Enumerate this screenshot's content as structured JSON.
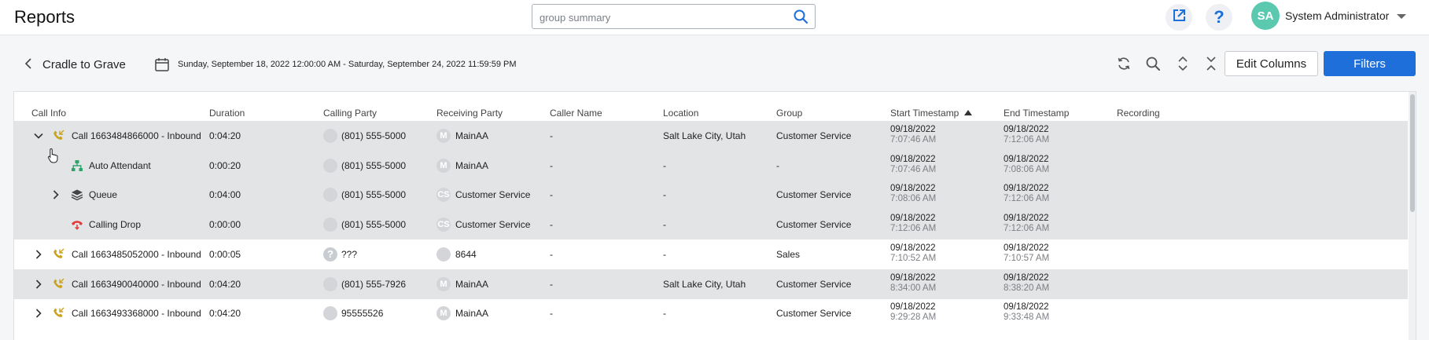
{
  "header": {
    "title": "Reports",
    "search_placeholder": "group summary",
    "user": {
      "initials": "SA",
      "name": "System Administrator"
    }
  },
  "toolbar": {
    "report_name": "Cradle to Grave",
    "date_range": "Sunday, September 18, 2022 12:00:00 AM - Saturday, September 24, 2022 11:59:59 PM",
    "edit_columns_label": "Edit Columns",
    "filters_label": "Filters"
  },
  "table": {
    "columns": [
      "Call Info",
      "Duration",
      "Calling Party",
      "Receiving Party",
      "Caller Name",
      "Location",
      "Group",
      "Start Timestamp",
      "End Timestamp",
      "Recording"
    ],
    "sorted_column": "Start Timestamp",
    "sort_direction": "ascending",
    "rows": [
      {
        "expander": "expanded",
        "indent": 0,
        "icon": "phone-inbound-icon",
        "call_info": "Call 1663484866000 - Inbound",
        "duration": "0:04:20",
        "calling_avatar": "",
        "calling_party": "(801) 555-5000",
        "receiving_avatar": "M",
        "receiving_party": "MainAA",
        "caller_name": "-",
        "location": "Salt Lake City, Utah",
        "group": "Customer Service",
        "start_date": "09/18/2022",
        "start_time": "7:07:46 AM",
        "end_date": "09/18/2022",
        "end_time": "7:12:06 AM",
        "shaded": true
      },
      {
        "expander": "none",
        "indent": 1,
        "icon": "auto-attendant-icon",
        "call_info": "Auto Attendant",
        "duration": "0:00:20",
        "calling_avatar": "",
        "calling_party": "(801) 555-5000",
        "receiving_avatar": "M",
        "receiving_party": "MainAA",
        "caller_name": "-",
        "location": "-",
        "group": "-",
        "start_date": "09/18/2022",
        "start_time": "7:07:46 AM",
        "end_date": "09/18/2022",
        "end_time": "7:08:06 AM",
        "shaded": true
      },
      {
        "expander": "collapsed",
        "indent": 1,
        "icon": "queue-layers-icon",
        "call_info": "Queue",
        "duration": "0:04:00",
        "calling_avatar": "",
        "calling_party": "(801) 555-5000",
        "receiving_avatar": "CS",
        "receiving_party": "Customer Service",
        "caller_name": "-",
        "location": "-",
        "group": "Customer Service",
        "start_date": "09/18/2022",
        "start_time": "7:08:06 AM",
        "end_date": "09/18/2022",
        "end_time": "7:12:06 AM",
        "shaded": true
      },
      {
        "expander": "none",
        "indent": 1,
        "icon": "call-drop-icon",
        "call_info": "Calling Drop",
        "duration": "0:00:00",
        "calling_avatar": "",
        "calling_party": "(801) 555-5000",
        "receiving_avatar": "CS",
        "receiving_party": "Customer Service",
        "caller_name": "-",
        "location": "-",
        "group": "Customer Service",
        "start_date": "09/18/2022",
        "start_time": "7:12:06 AM",
        "end_date": "09/18/2022",
        "end_time": "7:12:06 AM",
        "shaded": true
      },
      {
        "expander": "collapsed",
        "indent": 0,
        "icon": "phone-inbound-icon",
        "call_info": "Call 1663485052000 - Inbound",
        "duration": "0:00:05",
        "calling_avatar": "?",
        "calling_party": "???",
        "receiving_avatar": "",
        "receiving_party": "8644",
        "caller_name": "-",
        "location": "-",
        "group": "Sales",
        "start_date": "09/18/2022",
        "start_time": "7:10:52 AM",
        "end_date": "09/18/2022",
        "end_time": "7:10:57 AM",
        "shaded": false
      },
      {
        "expander": "collapsed",
        "indent": 0,
        "icon": "phone-inbound-icon",
        "call_info": "Call 1663490040000 - Inbound",
        "duration": "0:04:20",
        "calling_avatar": "",
        "calling_party": "(801) 555-7926",
        "receiving_avatar": "M",
        "receiving_party": "MainAA",
        "caller_name": "-",
        "location": "Salt Lake City, Utah",
        "group": "Customer Service",
        "start_date": "09/18/2022",
        "start_time": "8:34:00 AM",
        "end_date": "09/18/2022",
        "end_time": "8:38:20 AM",
        "shaded": true
      },
      {
        "expander": "collapsed",
        "indent": 0,
        "icon": "phone-inbound-icon",
        "call_info": "Call 1663493368000 - Inbound",
        "duration": "0:04:20",
        "calling_avatar": "",
        "calling_party": "95555526",
        "receiving_avatar": "M",
        "receiving_party": "MainAA",
        "caller_name": "-",
        "location": "-",
        "group": "Customer Service",
        "start_date": "09/18/2022",
        "start_time": "9:29:28 AM",
        "end_date": "09/18/2022",
        "end_time": "9:33:48 AM",
        "shaded": false
      }
    ]
  },
  "colors": {
    "accent": "#1e6fd9",
    "avatar": "#5bc8b0",
    "phone_icon": "#c9a21e",
    "auto_attendant_icon": "#2fa36b",
    "call_drop_icon": "#e23b3b",
    "queue_icon": "#444444"
  }
}
